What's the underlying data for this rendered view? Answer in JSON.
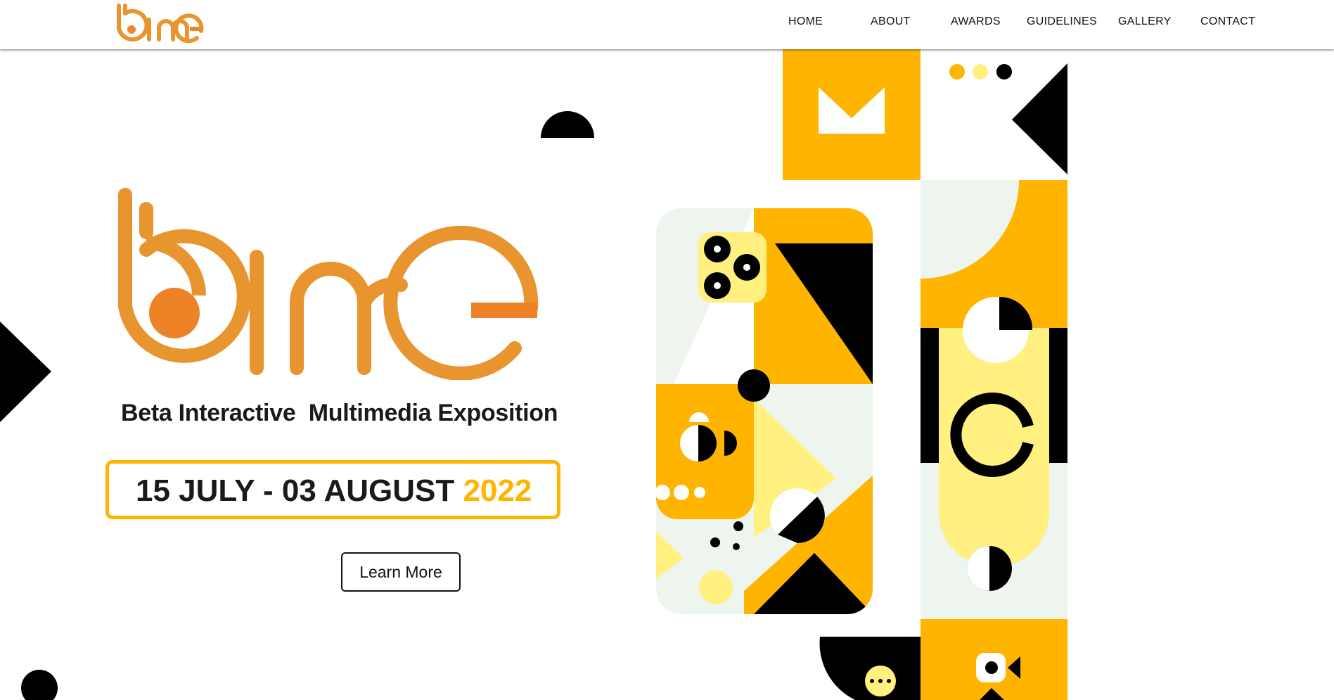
{
  "header": {
    "logo_text": "bime",
    "nav": [
      {
        "label": "HOME"
      },
      {
        "label": "ABOUT"
      },
      {
        "label": "AWARDS"
      },
      {
        "label": "GUIDELINES"
      },
      {
        "label": "GALLERY"
      },
      {
        "label": "CONTACT"
      }
    ]
  },
  "hero": {
    "logo_text": "bime",
    "tagline": "Beta Interactive  Multimedia Exposition",
    "date_main": "15 JULY - 03 AUGUST ",
    "date_year": "2022",
    "cta_label": "Learn More"
  },
  "colors": {
    "brand_orange": "#e8952f",
    "accent_yellow": "#ffb400",
    "light_yellow": "#fff07f",
    "mint": "#eef5ee",
    "black": "#000000"
  }
}
